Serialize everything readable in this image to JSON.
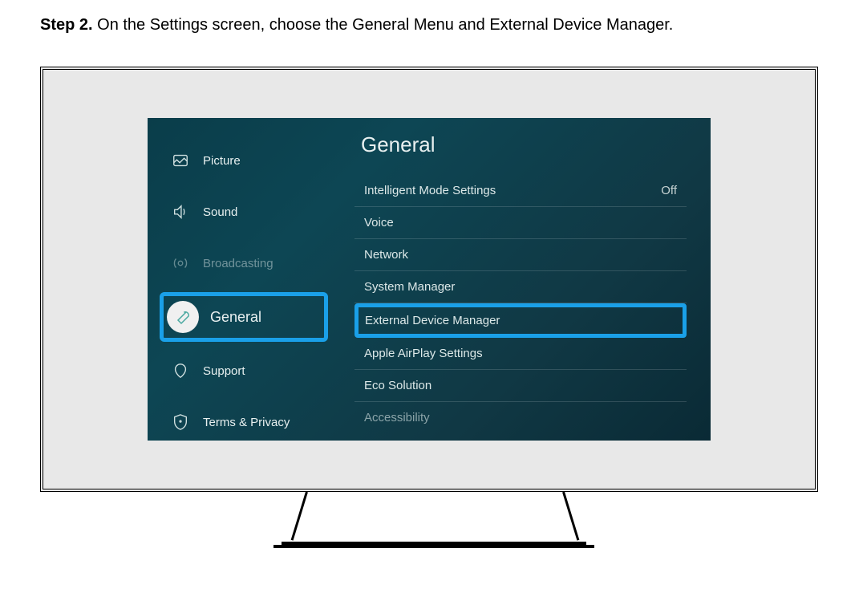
{
  "instruction": {
    "step_label": "Step 2.",
    "text": "On the Settings screen, choose the General Menu and External Device Manager."
  },
  "sidebar": {
    "items": [
      {
        "label": "Picture",
        "icon": "picture-icon",
        "dim": false
      },
      {
        "label": "Sound",
        "icon": "sound-icon",
        "dim": false
      },
      {
        "label": "Broadcasting",
        "icon": "broadcasting-icon",
        "dim": true
      },
      {
        "label": "General",
        "icon": "wrench-icon",
        "highlighted": true
      },
      {
        "label": "Support",
        "icon": "support-icon",
        "dim": false
      },
      {
        "label": "Terms & Privacy",
        "icon": "shield-icon",
        "dim": false
      }
    ]
  },
  "panel": {
    "title": "General",
    "items": [
      {
        "label": "Intelligent Mode Settings",
        "value": "Off"
      },
      {
        "label": "Voice",
        "value": ""
      },
      {
        "label": "Network",
        "value": ""
      },
      {
        "label": "System Manager",
        "value": ""
      },
      {
        "label": "External Device Manager",
        "value": "",
        "highlighted": true
      },
      {
        "label": "Apple AirPlay Settings",
        "value": ""
      },
      {
        "label": "Eco Solution",
        "value": ""
      },
      {
        "label": "Accessibility",
        "value": "",
        "partial": true
      }
    ]
  }
}
